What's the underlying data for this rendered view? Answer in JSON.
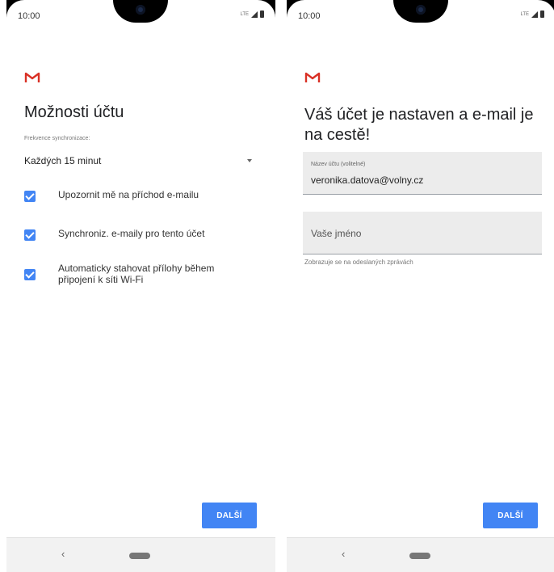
{
  "left": {
    "status_time": "10:00",
    "status_lte": "LTE",
    "title": "Možnosti účtu",
    "sync_frequency_label": "Frekvence synchronizace:",
    "sync_frequency_value": "Každých 15 minut",
    "checkboxes": [
      {
        "label": "Upozornit mě na příchod e-mailu",
        "checked": true
      },
      {
        "label": "Synchroniz. e-maily pro tento účet",
        "checked": true
      },
      {
        "label": "Automaticky stahovat přílohy během připojení k síti Wi-Fi",
        "checked": true
      }
    ],
    "next_label": "DALŠÍ",
    "nav_back": "‹"
  },
  "right": {
    "status_time": "10:00",
    "status_lte": "LTE",
    "title": "Váš účet je nastaven a e-mail je na cestě!",
    "account_name_label": "Název účtu (volitelné)",
    "account_name_value": "veronika.datova@volny.cz",
    "your_name_placeholder": "Vaše jméno",
    "your_name_helper": "Zobrazuje se na odeslaných zprávách",
    "next_label": "DALŠÍ",
    "nav_back": "‹"
  },
  "colors": {
    "accent": "#4285f4",
    "gmail_red": "#d93025",
    "field_bg": "#ececec"
  }
}
